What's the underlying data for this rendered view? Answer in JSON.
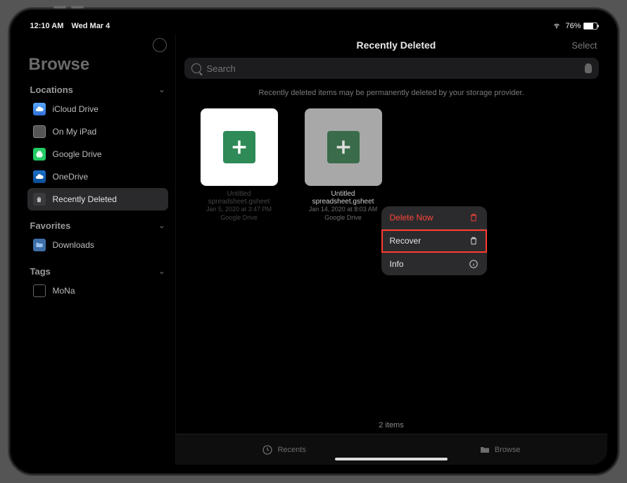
{
  "statusbar": {
    "time": "12:10 AM",
    "date": "Wed Mar 4",
    "battery_pct": "76%"
  },
  "sidebar": {
    "browse_title": "Browse",
    "sections": {
      "locations_label": "Locations",
      "favorites_label": "Favorites",
      "tags_label": "Tags"
    },
    "locations": [
      {
        "label": "iCloud Drive"
      },
      {
        "label": "On My iPad"
      },
      {
        "label": "Google Drive"
      },
      {
        "label": "OneDrive"
      },
      {
        "label": "Recently Deleted"
      }
    ],
    "favorites": [
      {
        "label": "Downloads"
      }
    ],
    "tags": [
      {
        "label": "MoNa"
      }
    ]
  },
  "main": {
    "title": "Recently Deleted",
    "select_label": "Select",
    "search_placeholder": "Search",
    "warning_text": "Recently deleted items may be permanently deleted by your storage provider.",
    "files": [
      {
        "name": "Untitled spreadsheet.gsheet",
        "date": "Jan 5, 2020 at 3:47 PM",
        "source": "Google Drive"
      },
      {
        "name": "Untitled spreadsheet.gsheet",
        "date": "Jan 14, 2020 at 8:03 AM",
        "source": "Google Drive"
      }
    ],
    "footer_count": "2 items"
  },
  "context_menu": {
    "delete_label": "Delete Now",
    "recover_label": "Recover",
    "info_label": "Info"
  },
  "tabbar": {
    "recents": "Recents",
    "browse": "Browse"
  }
}
